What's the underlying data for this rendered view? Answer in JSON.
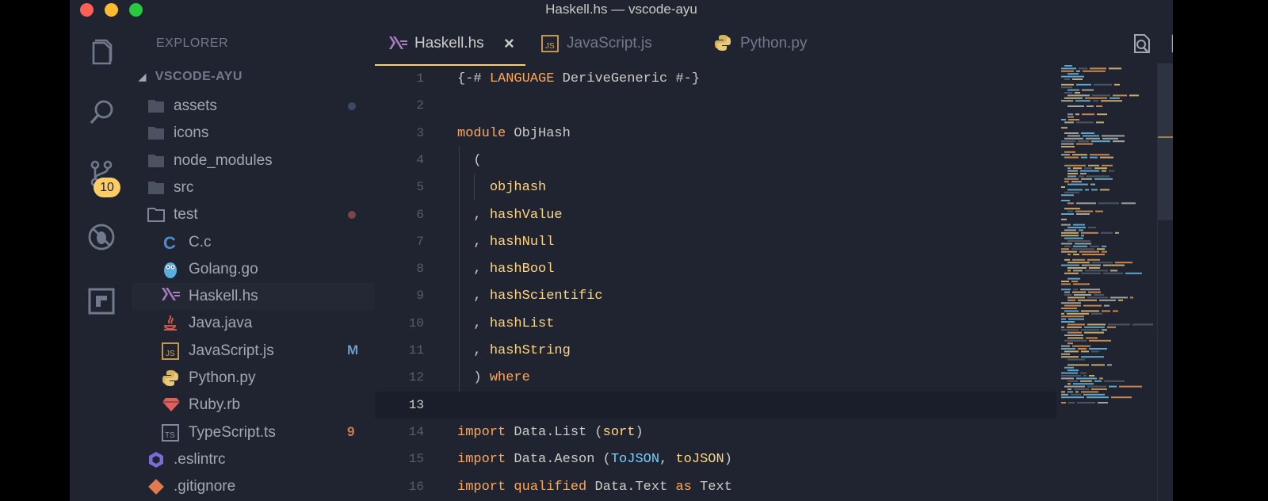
{
  "window": {
    "title": "Haskell.hs — vscode-ayu",
    "traffic_colors": [
      "#ff5f57",
      "#febc2e",
      "#28c840"
    ]
  },
  "activity_bar": {
    "items": [
      {
        "name": "explorer-icon"
      },
      {
        "name": "search-icon"
      },
      {
        "name": "source-control-icon",
        "badge": "10"
      },
      {
        "name": "debug-icon"
      },
      {
        "name": "extensions-icon"
      }
    ]
  },
  "sidebar": {
    "title": "EXPLORER",
    "section": "VSCODE-AYU",
    "items": [
      {
        "label": "assets",
        "icon": "folder-icon",
        "indent": 0,
        "status": "dot",
        "status_color": "#3b4b66"
      },
      {
        "label": "icons",
        "icon": "folder-icon",
        "indent": 0
      },
      {
        "label": "node_modules",
        "icon": "folder-icon",
        "indent": 0
      },
      {
        "label": "src",
        "icon": "folder-icon",
        "indent": 0
      },
      {
        "label": "test",
        "icon": "folder-open-icon",
        "indent": 0,
        "status": "dot",
        "status_color": "#7a4646"
      },
      {
        "label": "C.c",
        "icon": "c-file-icon",
        "indent": 1
      },
      {
        "label": "Golang.go",
        "icon": "go-file-icon",
        "indent": 1
      },
      {
        "label": "Haskell.hs",
        "icon": "haskell-file-icon",
        "indent": 1,
        "selected": true
      },
      {
        "label": "Java.java",
        "icon": "java-file-icon",
        "indent": 1
      },
      {
        "label": "JavaScript.js",
        "icon": "js-file-icon",
        "indent": 1,
        "status": "M",
        "status_color": "#6e9bc5"
      },
      {
        "label": "Python.py",
        "icon": "python-file-icon",
        "indent": 1
      },
      {
        "label": "Ruby.rb",
        "icon": "ruby-file-icon",
        "indent": 1
      },
      {
        "label": "TypeScript.ts",
        "icon": "ts-file-icon",
        "indent": 1,
        "status": "9",
        "status_color": "#d07a5a"
      },
      {
        "label": ".eslintrc",
        "icon": "eslint-file-icon",
        "indent": 0
      },
      {
        "label": ".gitignore",
        "icon": "git-file-icon",
        "indent": 0
      }
    ]
  },
  "tabs": [
    {
      "label": "Haskell.hs",
      "icon": "haskell-file-icon",
      "active": true,
      "close": "×"
    },
    {
      "label": "JavaScript.js",
      "icon": "js-file-icon",
      "active": false
    },
    {
      "label": "Python.py",
      "icon": "python-file-icon",
      "active": false
    }
  ],
  "toolbar": [
    {
      "name": "open-changes-icon"
    },
    {
      "name": "split-editor-icon"
    },
    {
      "name": "more-actions-icon"
    }
  ],
  "editor": {
    "current_line": 13,
    "lines": [
      {
        "n": "1",
        "tokens": [
          [
            "{-# ",
            ""
          ],
          [
            "LANGUAGE",
            "kw"
          ],
          [
            " DeriveGeneric #-}",
            ""
          ]
        ]
      },
      {
        "n": "2",
        "tokens": []
      },
      {
        "n": "3",
        "tokens": [
          [
            "module",
            "kw"
          ],
          [
            " ObjHash",
            ""
          ]
        ]
      },
      {
        "n": "4",
        "tokens": [
          [
            "  (",
            ""
          ]
        ]
      },
      {
        "n": "5",
        "tokens": [
          [
            "    ",
            ""
          ],
          [
            "objhash",
            "fn"
          ]
        ]
      },
      {
        "n": "6",
        "tokens": [
          [
            "  , ",
            ""
          ],
          [
            "hashValue",
            "fn"
          ]
        ]
      },
      {
        "n": "7",
        "tokens": [
          [
            "  , ",
            ""
          ],
          [
            "hashNull",
            "fn"
          ]
        ]
      },
      {
        "n": "8",
        "tokens": [
          [
            "  , ",
            ""
          ],
          [
            "hashBool",
            "fn"
          ]
        ]
      },
      {
        "n": "9",
        "tokens": [
          [
            "  , ",
            ""
          ],
          [
            "hashScientific",
            "fn"
          ]
        ]
      },
      {
        "n": "10",
        "tokens": [
          [
            "  , ",
            ""
          ],
          [
            "hashList",
            "fn"
          ]
        ]
      },
      {
        "n": "11",
        "tokens": [
          [
            "  , ",
            ""
          ],
          [
            "hashString",
            "fn"
          ]
        ]
      },
      {
        "n": "12",
        "tokens": [
          [
            "  ) ",
            ""
          ],
          [
            "where",
            "kw"
          ]
        ]
      },
      {
        "n": "13",
        "tokens": []
      },
      {
        "n": "14",
        "tokens": [
          [
            "import",
            "kw"
          ],
          [
            " Data.List (",
            ""
          ],
          [
            "sort",
            "fn"
          ],
          [
            ")",
            ""
          ]
        ]
      },
      {
        "n": "15",
        "tokens": [
          [
            "import",
            "kw"
          ],
          [
            " Data.Aeson (",
            ""
          ],
          [
            "ToJSON",
            "ty"
          ],
          [
            ", ",
            ""
          ],
          [
            "toJSON",
            "fn"
          ],
          [
            ")",
            ""
          ]
        ]
      },
      {
        "n": "16",
        "tokens": [
          [
            "import",
            "kw"
          ],
          [
            " ",
            ""
          ],
          [
            "qualified",
            "kw"
          ],
          [
            " Data.Text ",
            ""
          ],
          [
            "as",
            "kw"
          ],
          [
            " Text",
            ""
          ]
        ]
      }
    ]
  },
  "colors": {
    "background": "#1f2430",
    "accent": "#ffcc66",
    "keyword": "#ffa759",
    "function": "#ffd580",
    "type": "#73d0ff"
  }
}
